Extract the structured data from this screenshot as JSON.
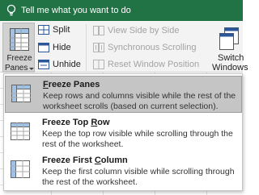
{
  "tell_me": {
    "text": "Tell me what you want to do"
  },
  "ribbon": {
    "freeze_panes": {
      "line1": "Freeze",
      "line2": "Panes"
    },
    "split": "Split",
    "hide": "Hide",
    "unhide": "Unhide",
    "view_side_by_side": "View Side by Side",
    "synchronous_scrolling": "Synchronous Scrolling",
    "reset_window_position": "Reset Window Position",
    "switch_windows": {
      "line1": "Switch",
      "line2": "Windows"
    }
  },
  "menu": {
    "items": [
      {
        "title_pre": "",
        "title_key": "F",
        "title_post": "reeze Panes",
        "description": "Keep rows and columns visible while the rest of the worksheet scrolls (based on current selection).",
        "selected": true
      },
      {
        "title_pre": "Freeze Top ",
        "title_key": "R",
        "title_post": "ow",
        "description": "Keep the top row visible while scrolling through the rest of the worksheet.",
        "selected": false
      },
      {
        "title_pre": "Freeze First ",
        "title_key": "C",
        "title_post": "olumn",
        "description": "Keep the first column visible while scrolling through the rest of the worksheet.",
        "selected": false
      }
    ]
  },
  "colors": {
    "accent": "#217346",
    "selected_bg": "#c5c5c5",
    "ribbon_bg": "#f3f3f3",
    "disabled_text": "#a3a3a3"
  },
  "icons": [
    "lightbulb-icon",
    "freeze-panes-icon",
    "split-icon",
    "hide-icon",
    "unhide-icon",
    "view-side-by-side-icon",
    "synchronous-scrolling-icon",
    "reset-window-position-icon",
    "switch-windows-icon",
    "freeze-top-row-icon",
    "freeze-first-column-icon"
  ]
}
